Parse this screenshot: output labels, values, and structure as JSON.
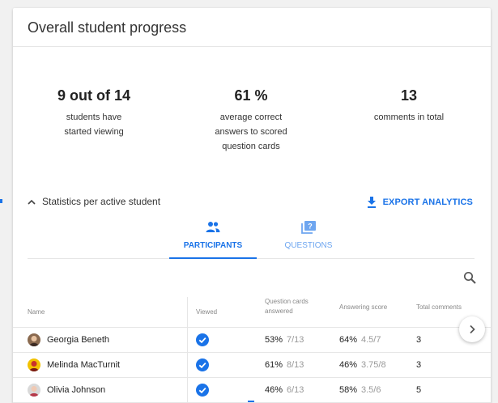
{
  "card": {
    "title": "Overall student progress"
  },
  "summary": [
    {
      "value": "9 out of 14",
      "description": "students have started viewing"
    },
    {
      "value": "61 %",
      "description": "average correct answers to scored question cards"
    },
    {
      "value": "13",
      "description": "comments in total"
    }
  ],
  "section": {
    "title": "Statistics per active student",
    "export_label": "EXPORT ANALYTICS"
  },
  "tabs": [
    {
      "label": "PARTICIPANTS",
      "icon": "people-icon",
      "active": true
    },
    {
      "label": "QUESTIONS",
      "icon": "question-cards-icon",
      "active": false
    }
  ],
  "table": {
    "headers": {
      "name": "Name",
      "viewed": "Viewed",
      "cards": "Question cards answered",
      "score": "Answering score",
      "total": "Total comments"
    },
    "rows": [
      {
        "name": "Georgia Beneth",
        "viewed": true,
        "cards_pct": "53%",
        "cards_frac": "7/13",
        "score_pct": "64%",
        "score_frac": "4.5/7",
        "comments": "3"
      },
      {
        "name": "Melinda MacTurnit",
        "viewed": true,
        "cards_pct": "61%",
        "cards_frac": "8/13",
        "score_pct": "46%",
        "score_frac": "3.75/8",
        "comments": "3"
      },
      {
        "name": "Olivia Johnson",
        "viewed": true,
        "cards_pct": "46%",
        "cards_frac": "6/13",
        "score_pct": "58%",
        "score_frac": "3.5/6",
        "comments": "5"
      }
    ]
  },
  "colors": {
    "accent": "#1a73e8",
    "check": "#1a73e8",
    "divider": "#e6e6e6"
  }
}
